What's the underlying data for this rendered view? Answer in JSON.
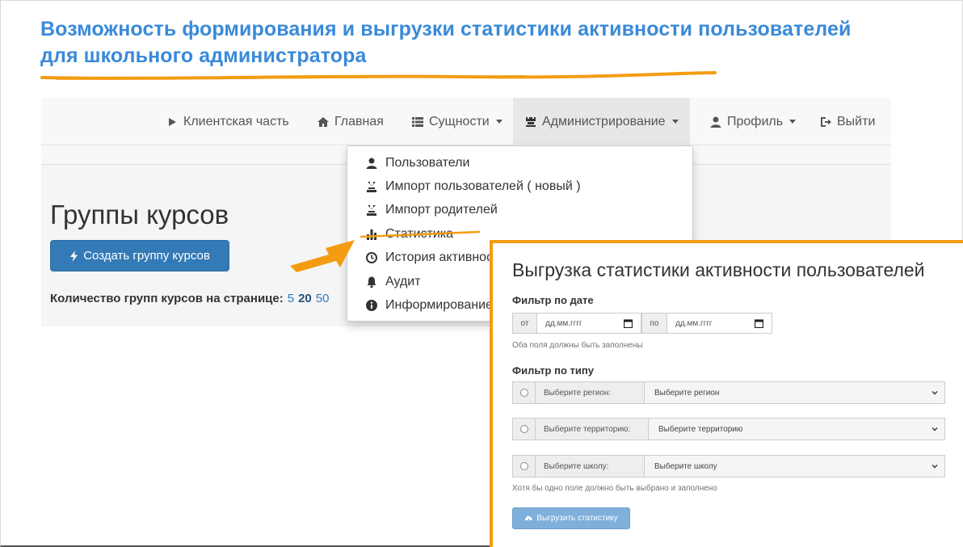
{
  "slide": {
    "title_line1": "Возможность формирования и выгрузки статистики активности пользователей",
    "title_line2": "для школьного администратора"
  },
  "navbar": {
    "items": [
      {
        "label": "Клиентская часть",
        "icon": "play-icon"
      },
      {
        "label": "Главная",
        "icon": "home-icon"
      },
      {
        "label": "Сущности",
        "icon": "list-icon"
      },
      {
        "label": "Администрирование",
        "icon": "tower-icon"
      },
      {
        "label": "Профиль",
        "icon": "user-icon"
      },
      {
        "label": "Выйти",
        "icon": "logout-icon"
      }
    ]
  },
  "page": {
    "heading": "Группы курсов",
    "create_button": "Создать группу курсов",
    "per_page_label": "Количество групп курсов на странице:",
    "per_page_options": [
      "5",
      "20",
      "50"
    ],
    "per_page_selected": "20"
  },
  "dropdown": {
    "items": [
      {
        "label": "Пользователи",
        "icon": "user-icon"
      },
      {
        "label": "Импорт пользователей ( новый )",
        "icon": "import-icon"
      },
      {
        "label": "Импорт родителей",
        "icon": "import-icon"
      },
      {
        "label": "Статистика",
        "icon": "stats-icon"
      },
      {
        "label": "История активности",
        "icon": "history-icon"
      },
      {
        "label": "Аудит",
        "icon": "bell-icon"
      },
      {
        "label": "Информирование",
        "icon": "info-icon"
      }
    ]
  },
  "export_panel": {
    "title": "Выгрузка статистики активности пользователей",
    "date_filter_label": "Фильтр по дате",
    "from_label": "от",
    "to_label": "по",
    "date_placeholder": "дд.мм.гггг",
    "date_help": "Оба поля должны быть заполнены",
    "type_filter_label": "Фильтр по типу",
    "rows": [
      {
        "label": "Выберите регион:",
        "select": "Выберите регион"
      },
      {
        "label": "Выберите территорию:",
        "select": "Выберите территорию"
      },
      {
        "label": "Выберите школу:",
        "select": "Выберите школу"
      }
    ],
    "type_help": "Хотя бы одно поле должно быть выбрано и заполнено",
    "export_button": "Выгрузить статистику"
  },
  "colors": {
    "title_blue": "#3a8ad8",
    "accent_orange": "#f39c12",
    "primary_button": "#337ab7"
  }
}
